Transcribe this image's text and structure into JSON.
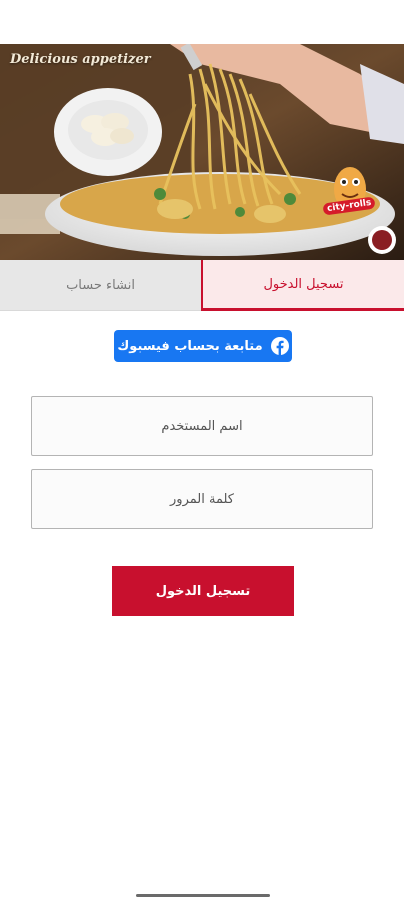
{
  "hero": {
    "banner_text": "Delicious appetizer",
    "brand_logo_text": "city-rolls"
  },
  "tabs": {
    "login": "تسجيل الدخول",
    "register": "انشاء حساب"
  },
  "facebook": {
    "label": "متابعة بحساب فيسبوك",
    "icon": "facebook-icon",
    "color": "#1877f2"
  },
  "form": {
    "username_placeholder": "اسم المستخدم",
    "password_placeholder": "كلمة المرور",
    "submit_label": "تسجيل الدخول"
  },
  "colors": {
    "accent": "#c8102e",
    "tab_active_bg": "#fbe9ea",
    "tab_inactive_bg": "#e7e7e7"
  }
}
